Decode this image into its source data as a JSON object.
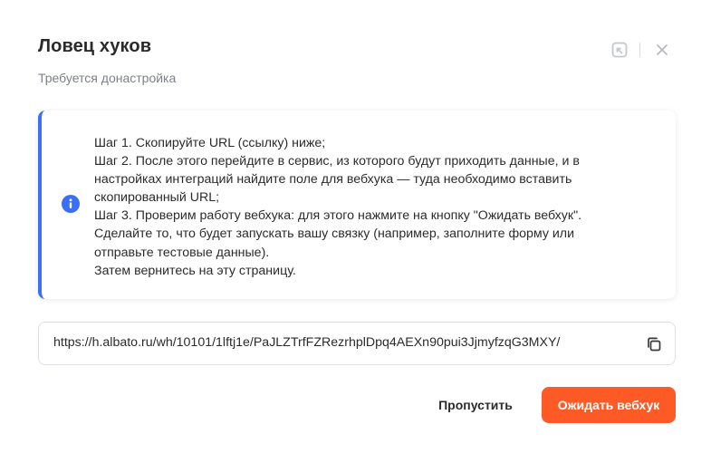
{
  "dialog": {
    "title": "Ловец хуков",
    "subtitle": "Требуется донастройка"
  },
  "header": {
    "minimize_icon": "collapse-icon",
    "close_icon": "close-icon"
  },
  "info": {
    "icon": "info-icon",
    "accent_color": "#3b6ff5",
    "lines": [
      "Шаг 1. Скопируйте URL (ссылку) ниже;",
      "Шаг 2. После этого перейдите в сервис, из которого будут приходить данные, и в",
      "настройках интеграций найдите поле для вебхука — туда необходимо вставить",
      "скопированный URL;",
      "Шаг 3. Проверим работу вебхука: для этого нажмите на кнопку \"Ожидать вебхук\".",
      "Сделайте то, что будет запускать вашу связку (например, заполните форму или",
      "отправьте тестовые данные).",
      "Затем вернитесь на эту страницу."
    ]
  },
  "url_field": {
    "value": "https://h.albato.ru/wh/10101/1lftj1e/PaJLZTrfFZRezrhplDpq4AEXn90pui3JjmyfzqG3MXY/",
    "copy_icon": "copy-icon"
  },
  "actions": {
    "skip_label": "Пропустить",
    "wait_label": "Ожидать вебхук",
    "primary_color": "#fd5a26"
  }
}
